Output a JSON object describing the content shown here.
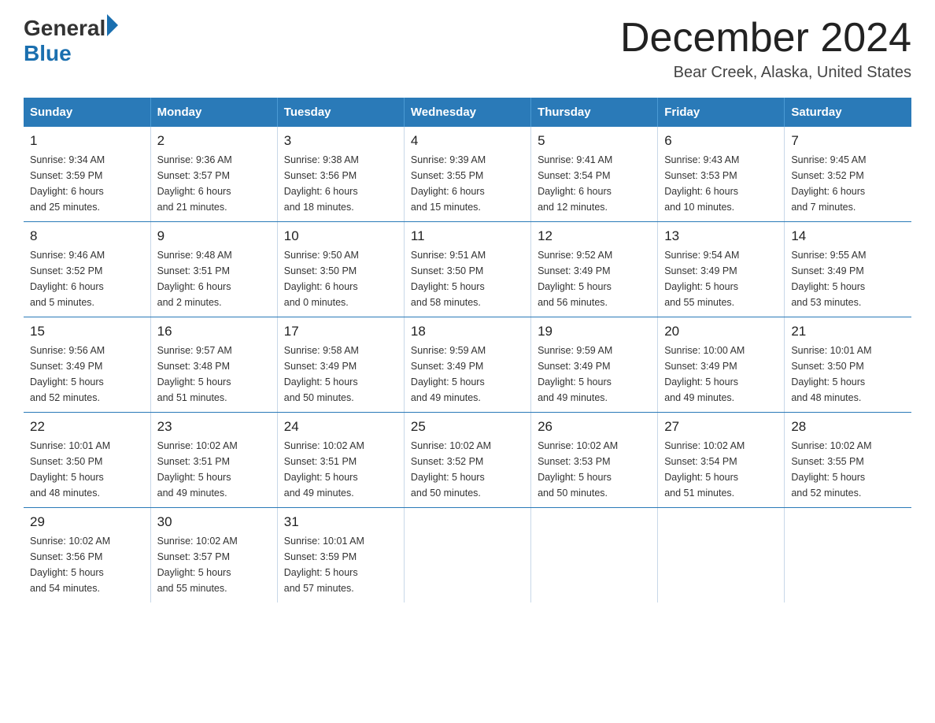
{
  "header": {
    "logo_general": "General",
    "logo_blue": "Blue",
    "month_title": "December 2024",
    "location": "Bear Creek, Alaska, United States"
  },
  "days_of_week": [
    "Sunday",
    "Monday",
    "Tuesday",
    "Wednesday",
    "Thursday",
    "Friday",
    "Saturday"
  ],
  "weeks": [
    [
      {
        "day": "1",
        "sunrise": "9:34 AM",
        "sunset": "3:59 PM",
        "daylight": "6 hours and 25 minutes."
      },
      {
        "day": "2",
        "sunrise": "9:36 AM",
        "sunset": "3:57 PM",
        "daylight": "6 hours and 21 minutes."
      },
      {
        "day": "3",
        "sunrise": "9:38 AM",
        "sunset": "3:56 PM",
        "daylight": "6 hours and 18 minutes."
      },
      {
        "day": "4",
        "sunrise": "9:39 AM",
        "sunset": "3:55 PM",
        "daylight": "6 hours and 15 minutes."
      },
      {
        "day": "5",
        "sunrise": "9:41 AM",
        "sunset": "3:54 PM",
        "daylight": "6 hours and 12 minutes."
      },
      {
        "day": "6",
        "sunrise": "9:43 AM",
        "sunset": "3:53 PM",
        "daylight": "6 hours and 10 minutes."
      },
      {
        "day": "7",
        "sunrise": "9:45 AM",
        "sunset": "3:52 PM",
        "daylight": "6 hours and 7 minutes."
      }
    ],
    [
      {
        "day": "8",
        "sunrise": "9:46 AM",
        "sunset": "3:52 PM",
        "daylight": "6 hours and 5 minutes."
      },
      {
        "day": "9",
        "sunrise": "9:48 AM",
        "sunset": "3:51 PM",
        "daylight": "6 hours and 2 minutes."
      },
      {
        "day": "10",
        "sunrise": "9:50 AM",
        "sunset": "3:50 PM",
        "daylight": "6 hours and 0 minutes."
      },
      {
        "day": "11",
        "sunrise": "9:51 AM",
        "sunset": "3:50 PM",
        "daylight": "5 hours and 58 minutes."
      },
      {
        "day": "12",
        "sunrise": "9:52 AM",
        "sunset": "3:49 PM",
        "daylight": "5 hours and 56 minutes."
      },
      {
        "day": "13",
        "sunrise": "9:54 AM",
        "sunset": "3:49 PM",
        "daylight": "5 hours and 55 minutes."
      },
      {
        "day": "14",
        "sunrise": "9:55 AM",
        "sunset": "3:49 PM",
        "daylight": "5 hours and 53 minutes."
      }
    ],
    [
      {
        "day": "15",
        "sunrise": "9:56 AM",
        "sunset": "3:49 PM",
        "daylight": "5 hours and 52 minutes."
      },
      {
        "day": "16",
        "sunrise": "9:57 AM",
        "sunset": "3:48 PM",
        "daylight": "5 hours and 51 minutes."
      },
      {
        "day": "17",
        "sunrise": "9:58 AM",
        "sunset": "3:49 PM",
        "daylight": "5 hours and 50 minutes."
      },
      {
        "day": "18",
        "sunrise": "9:59 AM",
        "sunset": "3:49 PM",
        "daylight": "5 hours and 49 minutes."
      },
      {
        "day": "19",
        "sunrise": "9:59 AM",
        "sunset": "3:49 PM",
        "daylight": "5 hours and 49 minutes."
      },
      {
        "day": "20",
        "sunrise": "10:00 AM",
        "sunset": "3:49 PM",
        "daylight": "5 hours and 49 minutes."
      },
      {
        "day": "21",
        "sunrise": "10:01 AM",
        "sunset": "3:50 PM",
        "daylight": "5 hours and 48 minutes."
      }
    ],
    [
      {
        "day": "22",
        "sunrise": "10:01 AM",
        "sunset": "3:50 PM",
        "daylight": "5 hours and 48 minutes."
      },
      {
        "day": "23",
        "sunrise": "10:02 AM",
        "sunset": "3:51 PM",
        "daylight": "5 hours and 49 minutes."
      },
      {
        "day": "24",
        "sunrise": "10:02 AM",
        "sunset": "3:51 PM",
        "daylight": "5 hours and 49 minutes."
      },
      {
        "day": "25",
        "sunrise": "10:02 AM",
        "sunset": "3:52 PM",
        "daylight": "5 hours and 50 minutes."
      },
      {
        "day": "26",
        "sunrise": "10:02 AM",
        "sunset": "3:53 PM",
        "daylight": "5 hours and 50 minutes."
      },
      {
        "day": "27",
        "sunrise": "10:02 AM",
        "sunset": "3:54 PM",
        "daylight": "5 hours and 51 minutes."
      },
      {
        "day": "28",
        "sunrise": "10:02 AM",
        "sunset": "3:55 PM",
        "daylight": "5 hours and 52 minutes."
      }
    ],
    [
      {
        "day": "29",
        "sunrise": "10:02 AM",
        "sunset": "3:56 PM",
        "daylight": "5 hours and 54 minutes."
      },
      {
        "day": "30",
        "sunrise": "10:02 AM",
        "sunset": "3:57 PM",
        "daylight": "5 hours and 55 minutes."
      },
      {
        "day": "31",
        "sunrise": "10:01 AM",
        "sunset": "3:59 PM",
        "daylight": "5 hours and 57 minutes."
      },
      null,
      null,
      null,
      null
    ]
  ],
  "sunrise_label": "Sunrise:",
  "sunset_label": "Sunset:",
  "daylight_label": "Daylight:"
}
